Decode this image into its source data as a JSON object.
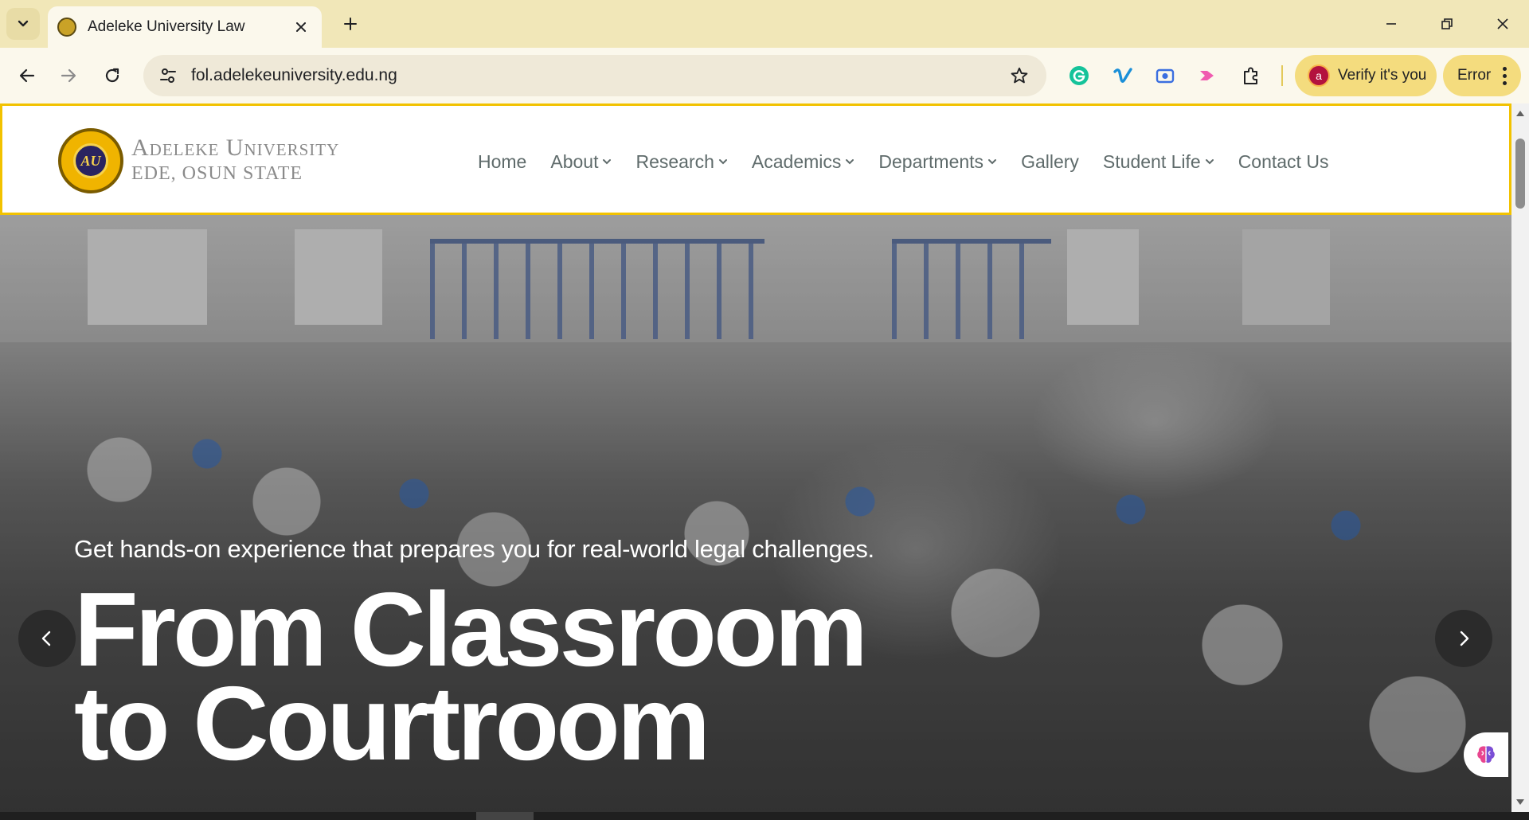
{
  "browser": {
    "tab": {
      "title": "Adeleke University Law"
    },
    "address_bar": {
      "url": "fol.adelekeuniversity.edu.ng"
    },
    "profile_chip": {
      "avatar_letter": "a",
      "label": "Verify it's you"
    },
    "error_chip": {
      "label": "Error"
    },
    "icons": {
      "tab_list": "chevron-down-icon",
      "close_tab": "close-icon",
      "new_tab": "plus-icon",
      "minimize": "minimize-icon",
      "restore": "restore-icon",
      "close_window": "close-icon",
      "back": "arrow-left-icon",
      "forward": "arrow-right-icon",
      "reload": "reload-icon",
      "site_info": "tune-icon",
      "bookmark": "star-icon",
      "extensions": [
        "grammarly-icon",
        "vimeo-icon",
        "screen-recorder-icon",
        "video-arrow-icon",
        "puzzle-icon"
      ]
    },
    "colors": {
      "tabstrip": "#f1e7b8",
      "toolbar": "#fbf8ec",
      "chip": "#f4dc7e"
    }
  },
  "site": {
    "logo": {
      "monogram": "AU",
      "line1": "Adeleke University",
      "line2": "EDE, OSUN STATE"
    },
    "nav": [
      {
        "label": "Home",
        "has_dropdown": false
      },
      {
        "label": "About",
        "has_dropdown": true
      },
      {
        "label": "Research",
        "has_dropdown": true
      },
      {
        "label": "Academics",
        "has_dropdown": true
      },
      {
        "label": "Departments",
        "has_dropdown": true
      },
      {
        "label": "Gallery",
        "has_dropdown": false
      },
      {
        "label": "Student Life",
        "has_dropdown": true
      },
      {
        "label": "Contact Us",
        "has_dropdown": false
      }
    ],
    "hero": {
      "subtitle": "Get hands-on experience that prepares you for real-world legal challenges.",
      "title_line1": "From Classroom",
      "title_line2": "to Courtroom"
    },
    "colors": {
      "header_border": "#f2c200",
      "nav_text": "#5f6b6b",
      "logo_gold": "#f0b400"
    }
  }
}
